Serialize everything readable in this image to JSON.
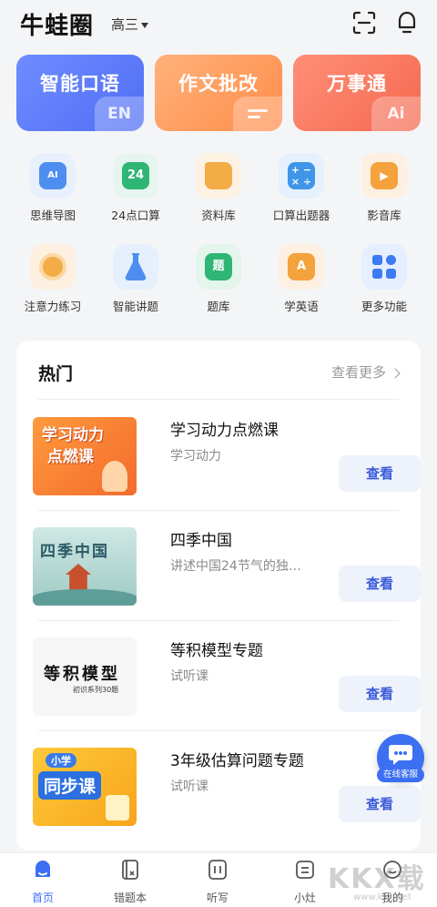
{
  "header": {
    "app_title": "牛蛙圈",
    "grade": "高三"
  },
  "features": [
    {
      "label": "智能口语",
      "badge": "EN"
    },
    {
      "label": "作文批改",
      "badge": ""
    },
    {
      "label": "万事通",
      "badge": "Ai"
    }
  ],
  "tools": [
    {
      "label": "思维导图",
      "icon": "mindmap-icon",
      "glyph": "AI"
    },
    {
      "label": "24点口算",
      "icon": "24-points-icon",
      "glyph": "24"
    },
    {
      "label": "资料库",
      "icon": "folder-icon",
      "glyph": ""
    },
    {
      "label": "口算出题器",
      "icon": "calculator-icon",
      "glyph": "+−\n×÷"
    },
    {
      "label": "影音库",
      "icon": "video-icon",
      "glyph": "▶"
    },
    {
      "label": "注意力练习",
      "icon": "target-icon",
      "glyph": ""
    },
    {
      "label": "智能讲题",
      "icon": "flask-icon",
      "glyph": ""
    },
    {
      "label": "题库",
      "icon": "question-bank-icon",
      "glyph": "题"
    },
    {
      "label": "学英语",
      "icon": "english-icon",
      "glyph": "A"
    },
    {
      "label": "更多功能",
      "icon": "more-apps-icon",
      "glyph": ""
    }
  ],
  "hot": {
    "title": "热门",
    "more": "查看更多",
    "courses": [
      {
        "title": "学习动力点燃课",
        "subtitle": "学习动力",
        "button": "查看",
        "thumb_text": "学习动力\n点燃课"
      },
      {
        "title": "四季中国",
        "subtitle": "讲述中国24节气的独…",
        "button": "查看",
        "thumb_text": "四季中国"
      },
      {
        "title": "等积模型专题",
        "subtitle": "试听课",
        "button": "查看",
        "thumb_text": "等积模型"
      },
      {
        "title": "3年级估算问题专题",
        "subtitle": "试听课",
        "button": "查看",
        "thumb_text": "同步课"
      }
    ]
  },
  "service": {
    "label": "在线客服"
  },
  "nav": [
    {
      "label": "首页",
      "active": true
    },
    {
      "label": "错题本",
      "active": false
    },
    {
      "label": "听写",
      "active": false
    },
    {
      "label": "小灶",
      "active": false
    },
    {
      "label": "我的",
      "active": false
    }
  ],
  "watermark": {
    "text": "KKX载",
    "url": "www.kkx.net"
  },
  "colors": {
    "primary": "#3d6ff2",
    "feature_blue": "#5b7bf7",
    "feature_orange": "#ff9a5c",
    "feature_red": "#f57a62"
  }
}
